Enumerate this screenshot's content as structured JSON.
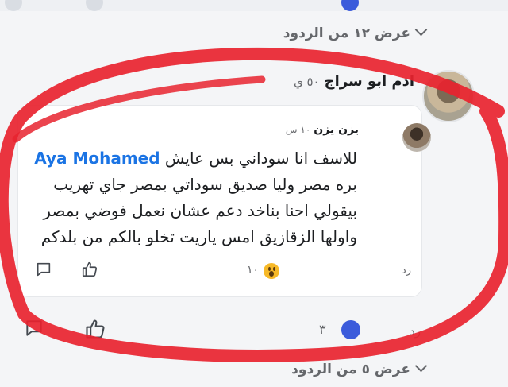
{
  "top_row": {},
  "view_replies_1": {
    "label": "عرض ١٢ من الردود"
  },
  "comment": {
    "author": "ادم ابو سراج",
    "time": "٥٠ ي"
  },
  "reply": {
    "author": "يزن يزن",
    "time": "١٠ س",
    "mention": "Aya Mohamed",
    "line1_after_mention": "للاسف انا سوداني بس عايش",
    "line2": "بره مصر وليا صديق سوداتي بمصر جاي تهريب",
    "line3": "بيقولي احنا بناخد دعم عشان نعمل فوضي بمصر",
    "line4": "واولها الزقازيق امس ياريت تخلو بالكم من بلدكم",
    "reply_label": "رد",
    "reaction_count": "١٠",
    "reaction_icon": "wow"
  },
  "comment_actions": {
    "reply_label": "رد",
    "reaction_count": "٣"
  },
  "view_replies_2": {
    "label": "عرض ٥ من الردود"
  },
  "colors": {
    "annotation_red": "#e8232f",
    "mention_blue": "#1b74e4",
    "muted": "#65676b"
  }
}
